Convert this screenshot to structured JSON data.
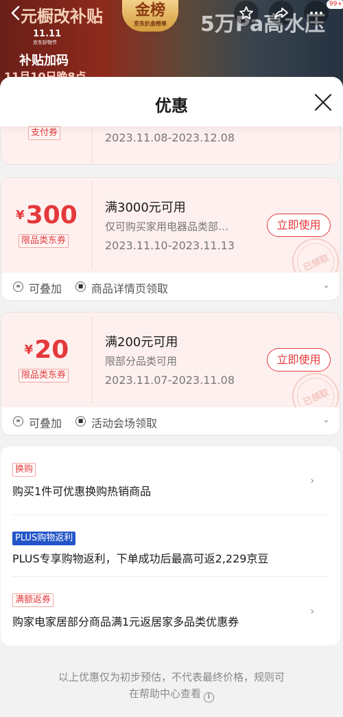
{
  "backdrop": {
    "banner_left": "元橱改补贴",
    "badge_title": "金榜",
    "badge_sub": "京东扒金榜单",
    "banner_right": "5万Pa高水压",
    "event_mark": "11.11",
    "event_mark_sub": "京东好物节",
    "sub_line": "补贴加码",
    "sub_line2": "11月10日晚8点",
    "cart_badge": "99+"
  },
  "sheet": {
    "title": "优惠"
  },
  "coupons": [
    {
      "tag": "支付券",
      "date": "2023.11.08-2023.12.08"
    },
    {
      "currency": "¥",
      "amount": "300",
      "tag": "限品类东券",
      "condition": "满3000元可用",
      "desc": "仅可购买家用电器品类部…",
      "date": "2023.11.10-2023.11.13",
      "button": "立即使用",
      "stamp": "已领取",
      "stack_label": "可叠加",
      "source_label": "商品详情页领取"
    },
    {
      "currency": "¥",
      "amount": "20",
      "tag": "限品类东券",
      "condition": "满200元可用",
      "desc": "限部分品类可用",
      "date": "2023.11.07-2023.11.08",
      "button": "立即使用",
      "stamp": "已领取",
      "stack_label": "可叠加",
      "source_label": "活动会场领取"
    }
  ],
  "promos": [
    {
      "tag": "换购",
      "text": "购买1件可优惠换购热销商品"
    },
    {
      "tag": "PLUS购物返利",
      "text": "PLUS专享购物返利，下单成功后最高可返2,229京豆"
    },
    {
      "tag": "满额返券",
      "text": "购家电家居部分商品满1元返居家多品类优惠券"
    }
  ],
  "disclaimer": {
    "line1": "以上优惠仅为初步预估，不代表最终价格，规则可",
    "line2": "在帮助中心查看"
  },
  "colors": {
    "accent": "#e4393c",
    "plus": "#2355c8",
    "coupon_bg": "#fef0ee"
  }
}
